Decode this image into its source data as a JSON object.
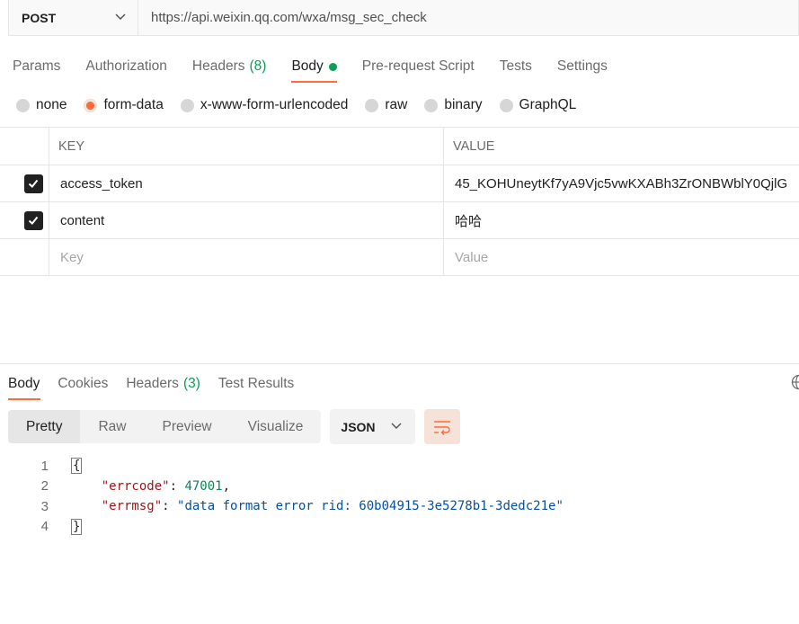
{
  "request": {
    "method": "POST",
    "url": "https://api.weixin.qq.com/wxa/msg_sec_check"
  },
  "request_tabs": [
    {
      "label": "Params"
    },
    {
      "label": "Authorization"
    },
    {
      "label": "Headers",
      "count": "(8)"
    },
    {
      "label": "Body"
    },
    {
      "label": "Pre-request Script"
    },
    {
      "label": "Tests"
    },
    {
      "label": "Settings"
    }
  ],
  "body_types": [
    "none",
    "form-data",
    "x-www-form-urlencoded",
    "raw",
    "binary",
    "GraphQL"
  ],
  "body_type_selected": "form-data",
  "kv_table": {
    "headers": {
      "key": "KEY",
      "value": "VALUE"
    },
    "rows": [
      {
        "key": "access_token",
        "value": "45_KOHUneytKf7yA9Vjc5vwKXABh3ZrONBWblY0QjlG"
      },
      {
        "key": "content",
        "value": "哈哈"
      }
    ],
    "placeholder": {
      "key": "Key",
      "value": "Value"
    }
  },
  "response_tabs": [
    {
      "label": "Body"
    },
    {
      "label": "Cookies"
    },
    {
      "label": "Headers",
      "count": "(3)"
    },
    {
      "label": "Test Results"
    }
  ],
  "view_modes": [
    "Pretty",
    "Raw",
    "Preview",
    "Visualize"
  ],
  "format": "JSON",
  "code": {
    "line_numbers": [
      "1",
      "2",
      "3",
      "4"
    ],
    "open_brace": "{",
    "close_brace": "}",
    "errcode_key": "\"errcode\"",
    "errcode_value": "47001",
    "errmsg_key": "\"errmsg\"",
    "errmsg_value": "\"data format error rid: 60b04915-3e5278b1-3dedc21e\""
  },
  "colors": {
    "accent": "#ff6c37",
    "count_green": "#0c9d58"
  }
}
